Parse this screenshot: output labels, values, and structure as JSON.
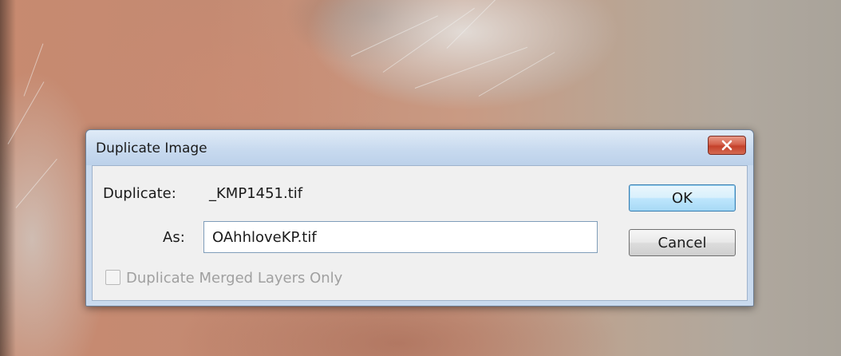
{
  "dialog": {
    "title": "Duplicate Image",
    "close_icon": "close-icon"
  },
  "form": {
    "duplicate_label": "Duplicate:",
    "duplicate_value": "_KMP1451.tif",
    "as_label": "As:",
    "as_value": "OAhhloveKP.tif",
    "merged_layers_label": "Duplicate Merged Layers Only",
    "merged_layers_checked": false,
    "merged_layers_disabled": true
  },
  "buttons": {
    "ok_label": "OK",
    "cancel_label": "Cancel"
  },
  "colors": {
    "title_bar": "#c8daef",
    "close_button": "#c4412b",
    "ok_button_border": "#3c7fb1"
  }
}
